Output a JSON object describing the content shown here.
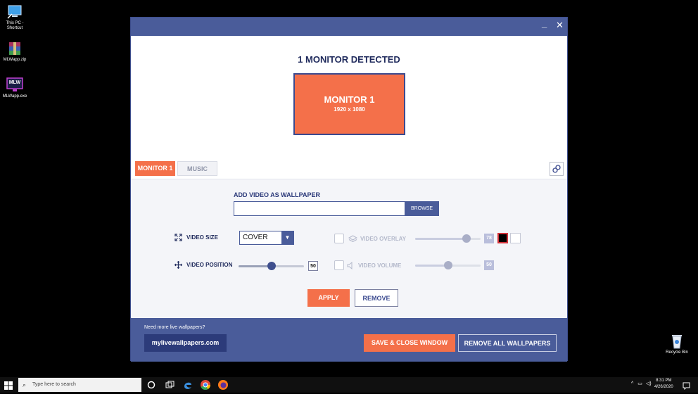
{
  "desktop": {
    "icons": [
      {
        "label": "This PC - Shortcut",
        "icon": "computer-icon"
      },
      {
        "label": "MLWapp.zip",
        "icon": "winrar-archive-icon"
      },
      {
        "label": "MLWapp.exe",
        "icon": "mlw-app-icon",
        "badge": "MLW"
      }
    ],
    "recycle_bin": {
      "label": "Recycle Bin",
      "icon": "recycle-bin-icon"
    }
  },
  "window": {
    "controls": {
      "minimize": "_",
      "close": "✕"
    },
    "detected_text": "1 MONITOR DETECTED",
    "monitor": {
      "name": "MONITOR 1",
      "resolution": "1920 x 1080"
    },
    "tabs": [
      {
        "label": "MONITOR 1",
        "active": true
      },
      {
        "label": "MUSIC",
        "active": false
      }
    ],
    "add_video": {
      "label": "ADD VIDEO AS WALLPAPER",
      "input_value": "",
      "browse_label": "BROWSE"
    },
    "video_size": {
      "label": "VIDEO SIZE",
      "selected": "COVER"
    },
    "video_position": {
      "label": "VIDEO POSITION",
      "value": "50",
      "fraction": 0.5
    },
    "video_overlay": {
      "label": "VIDEO OVERLAY",
      "value": "78",
      "fraction": 0.78,
      "enabled": false
    },
    "video_volume": {
      "label": "VIDEO VOLUME",
      "value": "50",
      "fraction": 0.5,
      "enabled": false
    },
    "apply_label": "APPLY",
    "remove_label": "REMOVE",
    "footer": {
      "need_more": "Need more live wallpapers?",
      "site_label": "mylivewallpapers.com",
      "save_close_label": "SAVE & CLOSE WINDOW",
      "remove_all_label": "REMOVE ALL WALLPAPERS"
    }
  },
  "taskbar": {
    "search_placeholder": "Type here to search",
    "time": "8:31 PM",
    "date": "4/26/2020"
  },
  "colors": {
    "accent_orange": "#f4704a",
    "primary_blue": "#4a5c9a",
    "dark_blue": "#2c3b7a"
  }
}
